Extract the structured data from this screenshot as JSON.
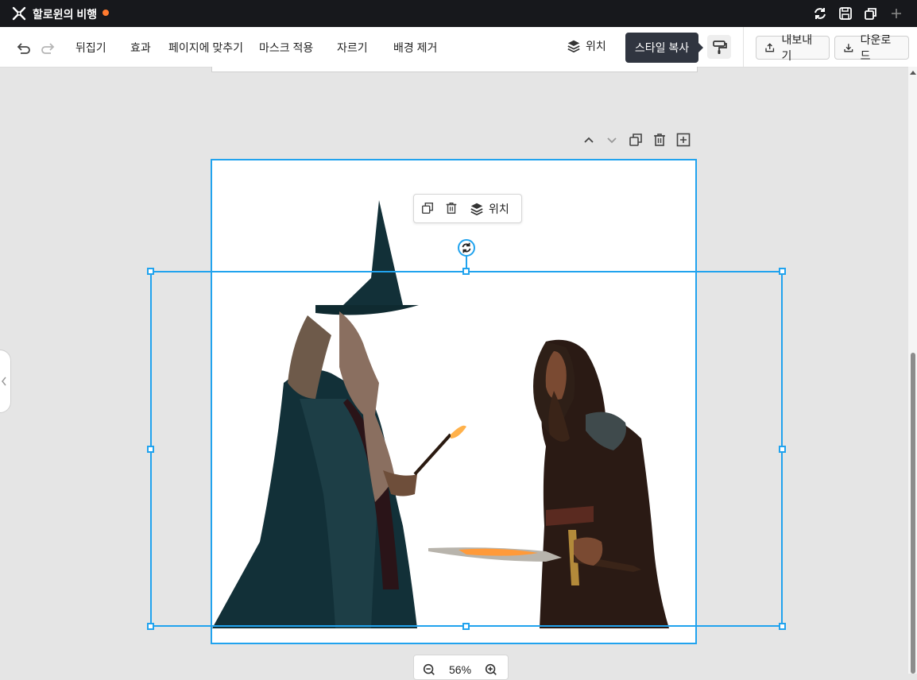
{
  "app": {
    "title": "할로윈의 비행",
    "unsaved_color": "#ff7a2f"
  },
  "toolbar": {
    "flip": "뒤집기",
    "effects": "효과",
    "fit_page": "페이지에 맞추기",
    "apply_mask": "마스크 적용",
    "crop": "자르기",
    "remove_bg": "배경 제거",
    "position": "위치",
    "export": "내보내기",
    "download": "다운로드"
  },
  "tooltip": "스타일 복사",
  "context_menu": {
    "position": "위치"
  },
  "zoom": {
    "level": "56%"
  },
  "colors": {
    "accent": "#21a3ee",
    "titlebar": "#17181c",
    "canvas": "#e5e5e5"
  },
  "icons": [
    "logo-icon",
    "sync-icon",
    "save-icon",
    "duplicate-icon",
    "plus-icon",
    "undo-icon",
    "redo-icon",
    "layers-icon",
    "paint-roller-icon",
    "export-icon",
    "download-icon",
    "chevron-up-icon",
    "chevron-down-icon",
    "trash-icon",
    "add-page-icon",
    "rotate-icon",
    "zoom-out-icon",
    "zoom-in-icon"
  ]
}
